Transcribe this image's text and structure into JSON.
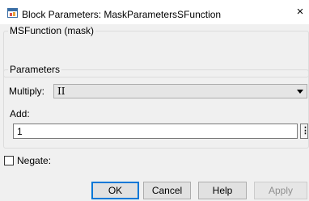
{
  "window": {
    "title": "Block Parameters: MaskParametersSFunction",
    "close_glyph": "×"
  },
  "description_group": {
    "title": "MSFunction (mask)"
  },
  "parameters_group": {
    "title": "Parameters",
    "multiply": {
      "label": "Multiply:",
      "value": "II"
    },
    "add": {
      "label": "Add:",
      "value": "1",
      "browse_label": "⋮"
    }
  },
  "negate": {
    "label": "Negate:",
    "checked": false
  },
  "buttons": {
    "ok": "OK",
    "cancel": "Cancel",
    "help": "Help",
    "apply": "Apply"
  },
  "icons": {
    "app": "simulink-block-icon",
    "close": "close-icon",
    "dropdown": "chevron-down-icon"
  }
}
